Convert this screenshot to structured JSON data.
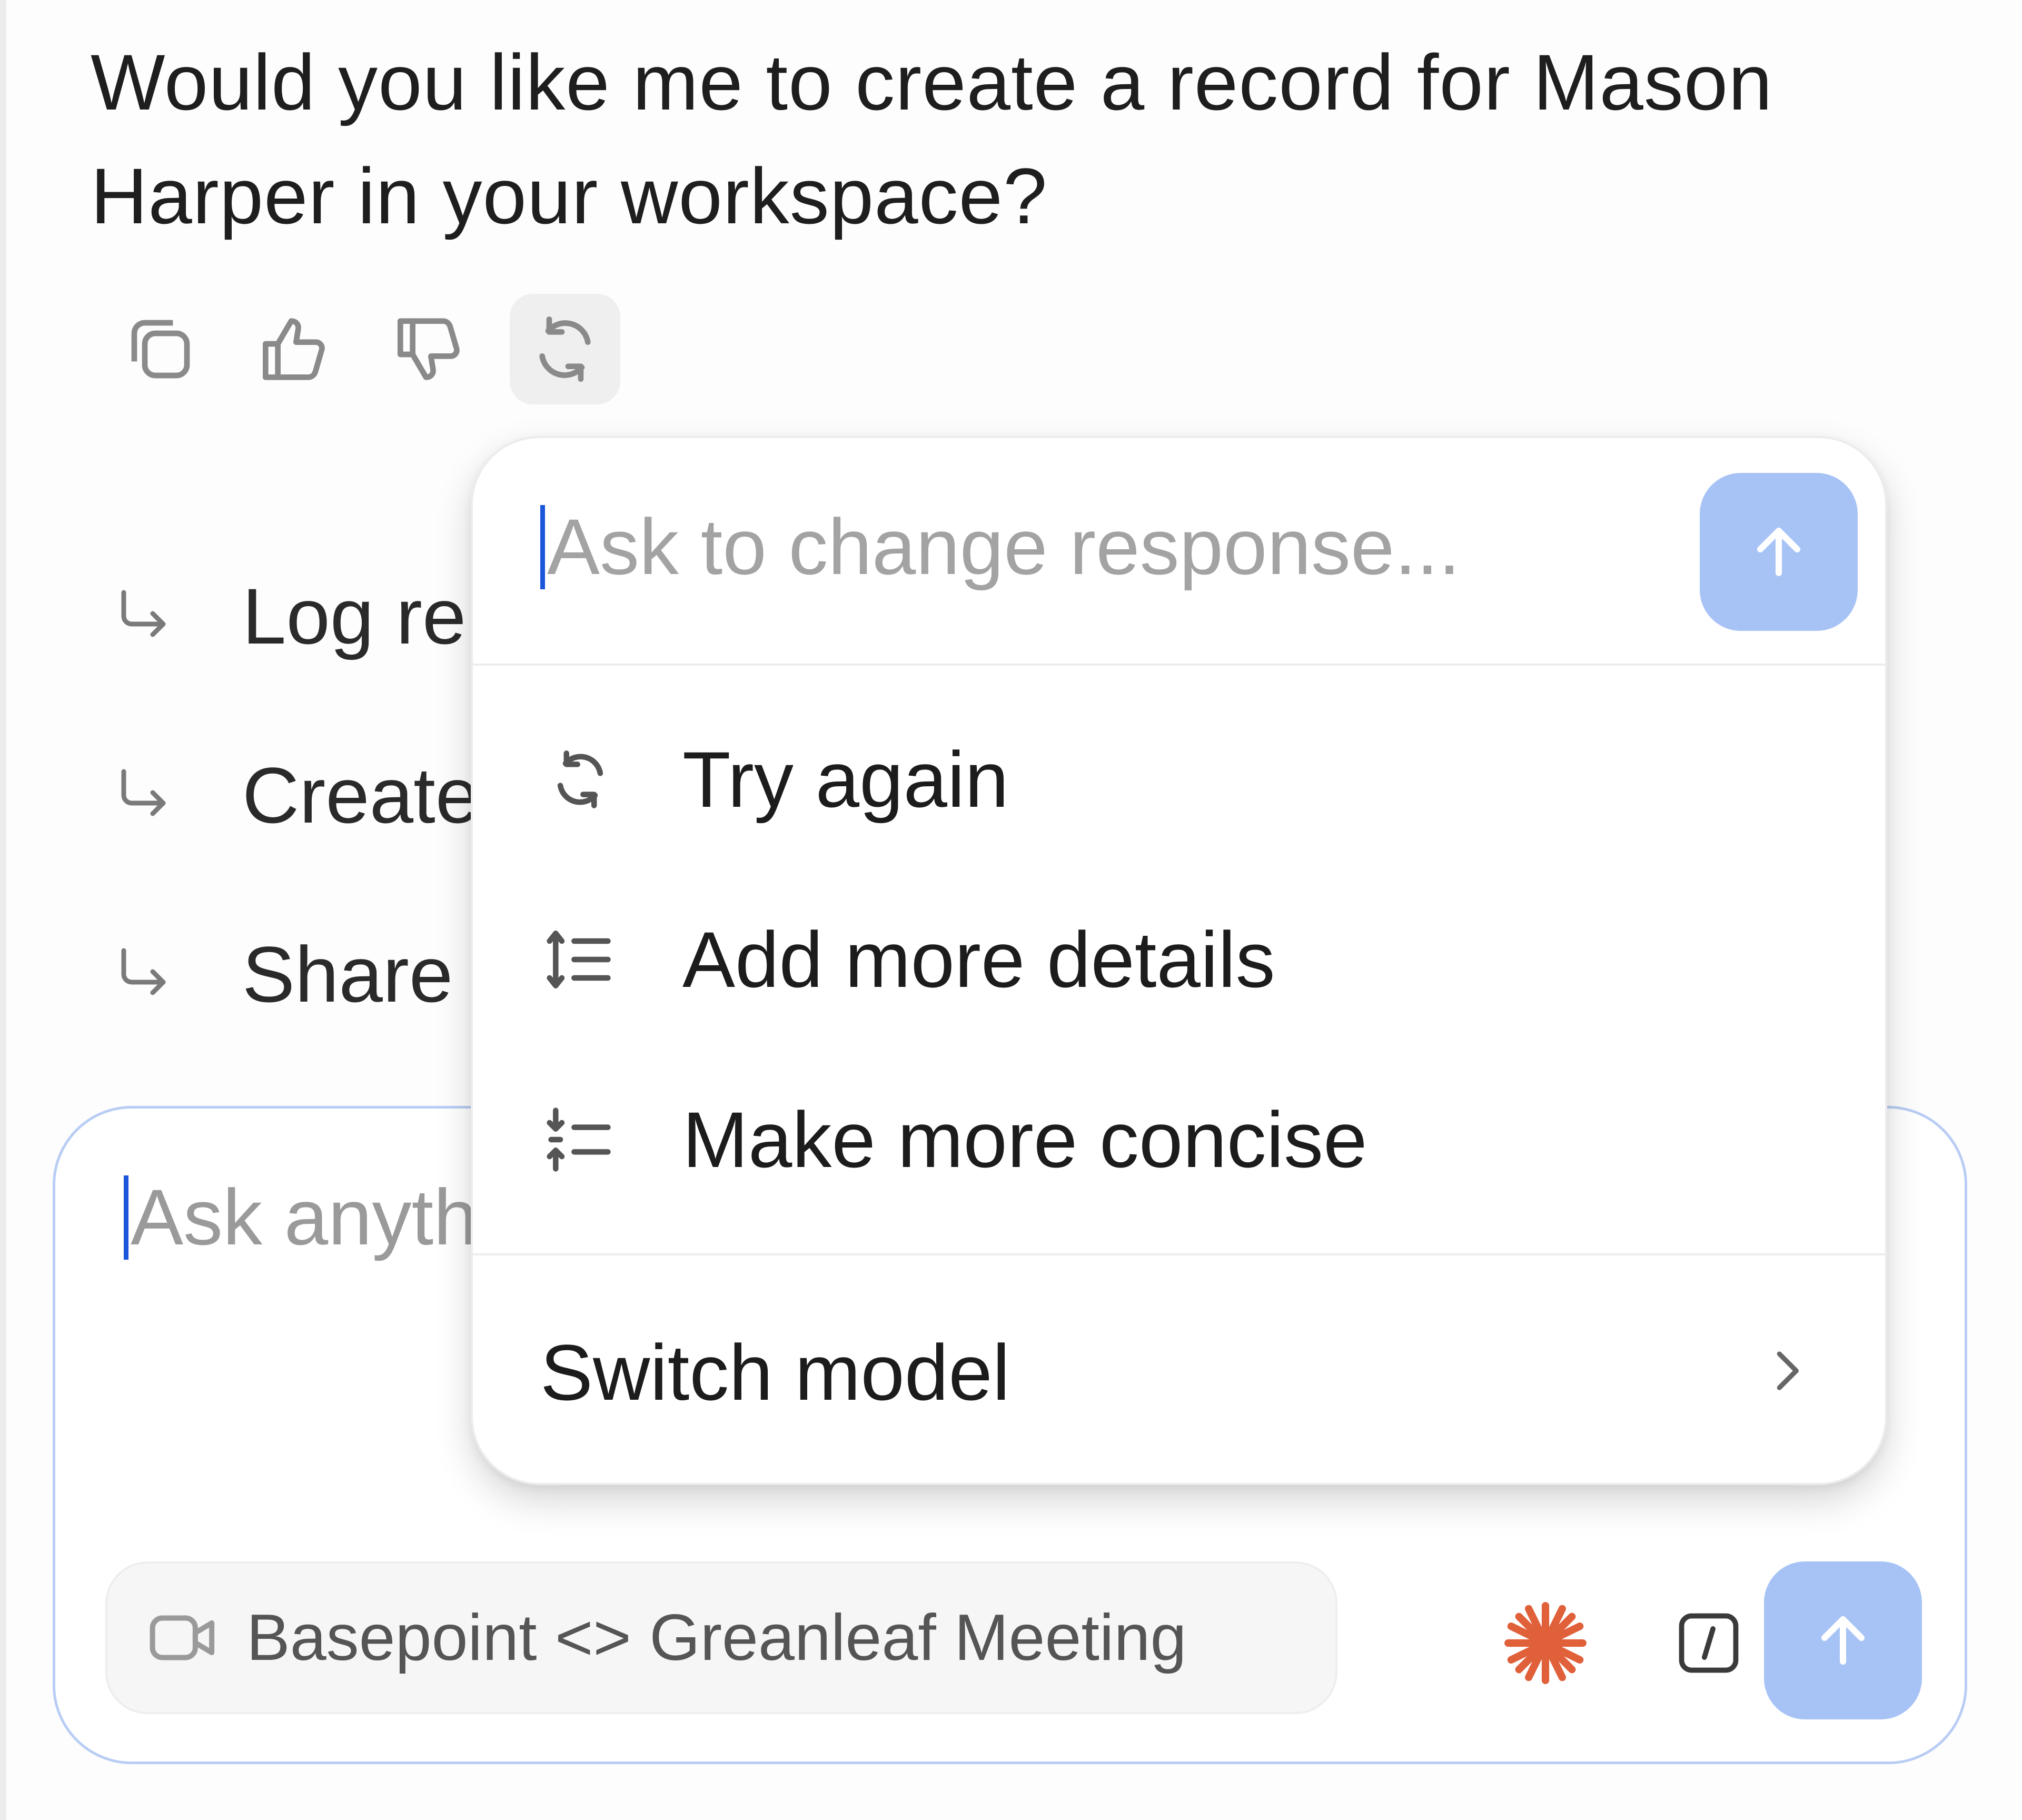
{
  "assistant_message": {
    "line1": "Would you like me to create a record for Mason",
    "line2": "Harper in your workspace?"
  },
  "message_actions": [
    {
      "icon": "copy-icon"
    },
    {
      "icon": "thumbs-up-icon"
    },
    {
      "icon": "thumbs-down-icon"
    },
    {
      "icon": "regenerate-icon",
      "active": true
    }
  ],
  "suggestions": [
    {
      "label": "Log re",
      "icon": "reply-arrow-icon"
    },
    {
      "label": "Create",
      "icon": "reply-arrow-icon"
    },
    {
      "label": "Share",
      "icon": "reply-arrow-icon"
    }
  ],
  "regenerate_menu": {
    "input_placeholder": "Ask to change response...",
    "items": [
      {
        "label": "Try again",
        "icon": "regenerate-icon"
      },
      {
        "label": "Add more details",
        "icon": "expand-list-icon"
      },
      {
        "label": "Make more concise",
        "icon": "compress-list-icon"
      }
    ],
    "switch_model_label": "Switch model"
  },
  "composer": {
    "placeholder": "Ask anyth",
    "context_chip_label": "Basepoint <> Greanleaf Meeting",
    "context_chip_icon": "video-camera-icon"
  },
  "colors": {
    "accent_send": "#a7c3f6",
    "caret": "#1a56d9",
    "composer_border": "#b9cdf4",
    "spark": "#e0603a"
  }
}
